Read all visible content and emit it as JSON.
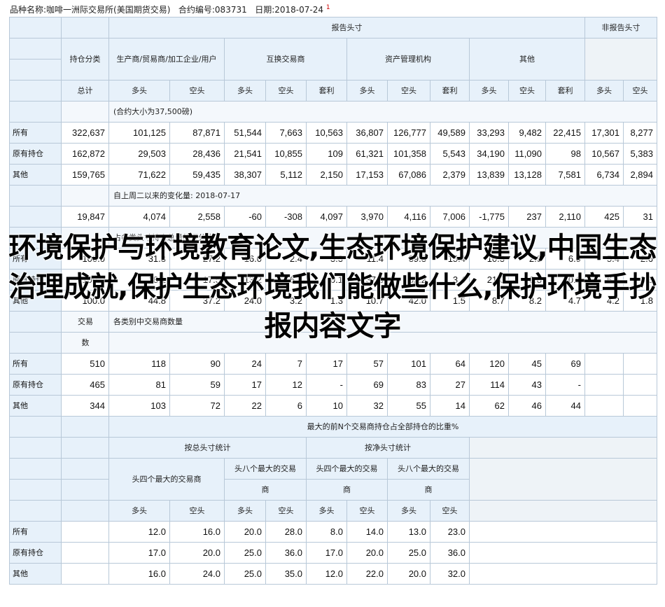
{
  "meta": {
    "product": "品种名称:咖啡一洲际交易所(美国期货交易)",
    "contract": "合约编号:083731",
    "date": "日期:2018-07-24",
    "note": "1"
  },
  "header": {
    "reportable": "报告头寸",
    "nonreportable": "非报告头寸",
    "category": "持仓分类",
    "producer": "生产商/贸易商/加工企业/用户",
    "swap": "互换交易商",
    "managed": "资产管理机构",
    "other": "其他",
    "total": "总计",
    "long": "多头",
    "short": "空头",
    "spread": "套利"
  },
  "sections": {
    "contract_size": "(合约大小为37,500磅)",
    "change": "自上周二以来的变化量: 2018-07-17",
    "pct": "占各类头寸持仓总量的百分比",
    "traders_cell": "交易",
    "traders_count": "数",
    "traders": "各类别中交易商数量"
  },
  "row_labels": {
    "all": "所有",
    "old": "原有持仓",
    "other": "其他"
  },
  "positions": [
    [
      "所有",
      "322,637",
      "101,125",
      "87,871",
      "51,544",
      "7,663",
      "10,563",
      "36,807",
      "126,777",
      "49,589",
      "33,293",
      "9,482",
      "22,415",
      "17,301",
      "8,277"
    ],
    [
      "原有持仓",
      "162,872",
      "29,503",
      "28,436",
      "21,541",
      "10,855",
      "109",
      "61,321",
      "101,358",
      "5,543",
      "34,190",
      "11,090",
      "98",
      "10,567",
      "5,383"
    ],
    [
      "其他",
      "159,765",
      "71,622",
      "59,435",
      "38,307",
      "5,112",
      "2,150",
      "17,153",
      "67,086",
      "2,379",
      "13,839",
      "13,128",
      "7,581",
      "6,734",
      "2,894"
    ]
  ],
  "changes": [
    "19,847",
    "4,074",
    "2,558",
    "-60",
    "-308",
    "4,097",
    "3,970",
    "4,116",
    "7,006",
    "-1,775",
    "237",
    "2,110",
    "425",
    "31"
  ],
  "percentages": [
    [
      "所有",
      "100.0",
      "31.3",
      "27.2",
      "16.0",
      "2.4",
      "3.3",
      "11.4",
      "39.3",
      "15.4",
      "10.3",
      "2.9",
      "6.9",
      "5.4",
      "2.6"
    ],
    [
      "原有持仓",
      "100.0",
      "18.1",
      "17.5",
      "13.2",
      "6.7",
      "0.1",
      "37.6",
      "62.2",
      "3.4",
      "21.0",
      "6.8",
      "0.1",
      "6.5",
      "3.3"
    ],
    [
      "其他",
      "100.0",
      "44.8",
      "37.2",
      "24.0",
      "3.2",
      "1.3",
      "10.7",
      "42.0",
      "1.5",
      "8.7",
      "8.2",
      "4.7",
      "4.2",
      "1.8"
    ]
  ],
  "traders": [
    [
      "所有",
      "510",
      "118",
      "90",
      "24",
      "7",
      "17",
      "57",
      "101",
      "64",
      "120",
      "45",
      "69",
      "",
      ""
    ],
    [
      "原有持仓",
      "465",
      "81",
      "59",
      "17",
      "12",
      "-",
      "69",
      "83",
      "27",
      "114",
      "43",
      "-",
      "",
      ""
    ],
    [
      "其他",
      "344",
      "103",
      "72",
      "22",
      "6",
      "10",
      "32",
      "55",
      "14",
      "62",
      "46",
      "44",
      "",
      ""
    ]
  ],
  "concentration": {
    "title": "最大的前N个交易商持仓占全部持仓的比重%",
    "gross": "按总头寸统计",
    "net": "按净头寸统计",
    "top4_gross": "头四个最大的交易商",
    "top8_gross_a": "头八个最大的交易",
    "top8_gross_b": "商",
    "top4_net_a": "头四个最大的交易",
    "top4_net_b": "商",
    "top8_net_a": "头八个最大的交易",
    "top8_net_b": "商",
    "long": "多头",
    "short": "空头",
    "rows": [
      [
        "所有",
        "12.0",
        "16.0",
        "20.0",
        "28.0",
        "8.0",
        "14.0",
        "13.0",
        "23.0"
      ],
      [
        "原有持仓",
        "17.0",
        "20.0",
        "25.0",
        "36.0",
        "17.0",
        "20.0",
        "25.0",
        "36.0"
      ],
      [
        "其他",
        "16.0",
        "24.0",
        "25.0",
        "35.0",
        "12.0",
        "22.0",
        "20.0",
        "32.0"
      ]
    ]
  },
  "overlay_text": "环境保护与环境教育论文,生态环境保护建议,中国生态治理成就,保护生态环境我们能做些什么,保护环境手抄报内容文字"
}
